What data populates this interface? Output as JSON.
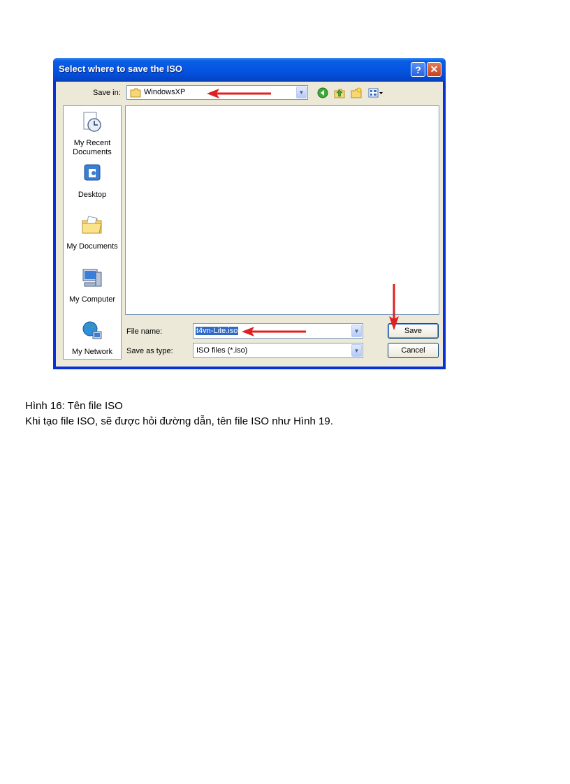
{
  "dialog": {
    "title": "Select where to save the ISO",
    "help_glyph": "?",
    "close_glyph": "✕",
    "save_in_label": "Save in:",
    "save_in_value": "WindowsXP",
    "toolbar_icons": [
      "back-icon",
      "up-folder-icon",
      "new-folder-icon",
      "views-icon"
    ],
    "places": [
      {
        "label": "My Recent Documents",
        "icon": "recent-documents-icon"
      },
      {
        "label": "Desktop",
        "icon": "desktop-icon"
      },
      {
        "label": "My Documents",
        "icon": "my-documents-icon"
      },
      {
        "label": "My Computer",
        "icon": "my-computer-icon"
      },
      {
        "label": "My Network",
        "icon": "my-network-icon"
      }
    ],
    "file_name_label": "File name:",
    "file_name_value": "t4vn-Lite.iso",
    "save_as_type_label": "Save as type:",
    "save_as_type_value": "ISO files (*.iso)",
    "save_button": "Save",
    "cancel_button": "Cancel"
  },
  "caption": {
    "line1": "Hình 16: Tên file ISO",
    "line2": "Khi tạo file ISO, sẽ được hỏi đường dẫn, tên file ISO như Hình 19."
  },
  "colors": {
    "title_bar": "#0554e3",
    "dialog_face": "#ece9d8",
    "annotation_arrow": "#e02020",
    "selection": "#316ac5"
  }
}
